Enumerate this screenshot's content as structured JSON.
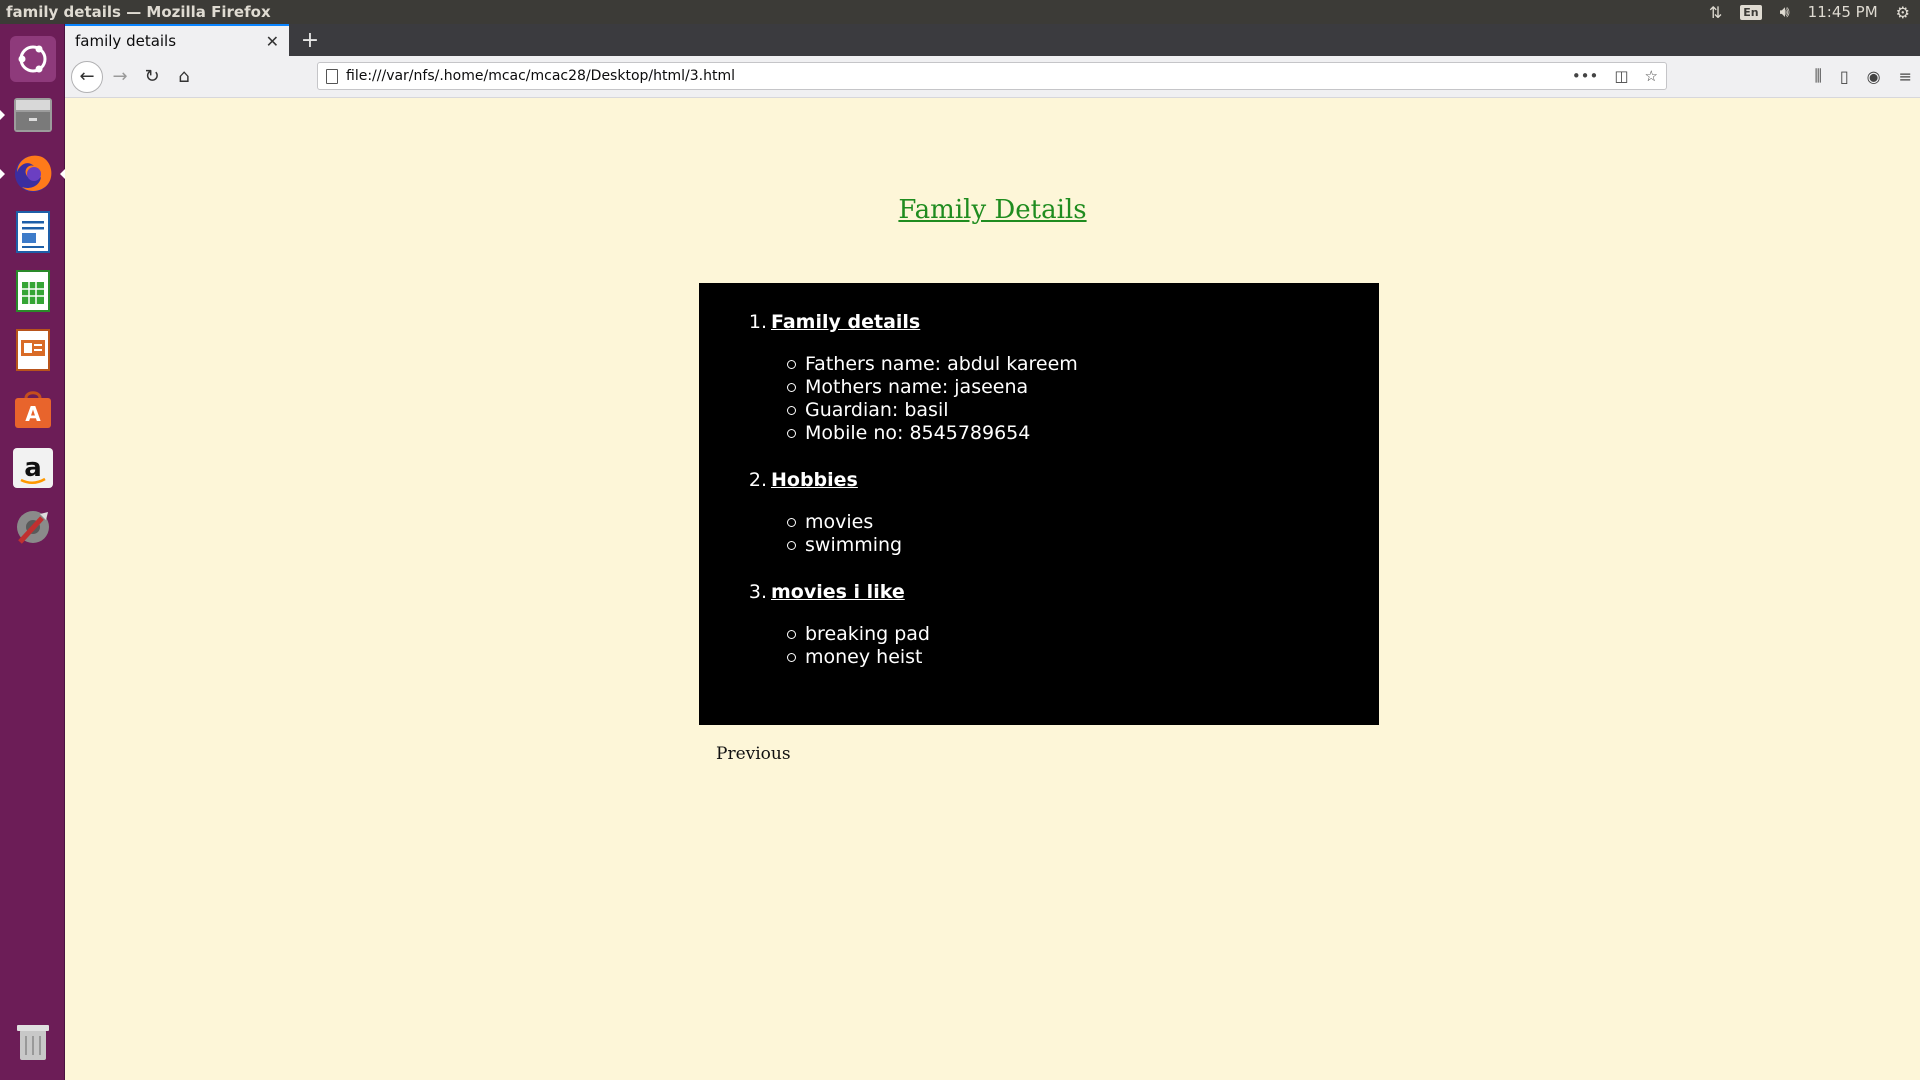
{
  "system": {
    "window_title": "family details — Mozilla Firefox",
    "lang": "En",
    "clock": "11:45 PM"
  },
  "launcher": {
    "items": [
      {
        "name": "ubuntu-dash-icon"
      },
      {
        "name": "files-icon"
      },
      {
        "name": "firefox-icon"
      },
      {
        "name": "writer-icon"
      },
      {
        "name": "calc-icon"
      },
      {
        "name": "impress-icon"
      },
      {
        "name": "software-center-icon"
      },
      {
        "name": "amazon-icon"
      },
      {
        "name": "system-settings-icon"
      },
      {
        "name": "trash-icon"
      }
    ]
  },
  "browser": {
    "tab_title": "family details",
    "url": "file:///var/nfs/.home/mcac/mcac28/Desktop/html/3.html"
  },
  "page": {
    "title": "Family Details",
    "sections": [
      {
        "num": "1.",
        "label": "Family details",
        "items": [
          "Fathers name: abdul kareem",
          "Mothers name: jaseena",
          "Guardian: basil",
          "Mobile no: 8545789654"
        ]
      },
      {
        "num": "2.",
        "label": "Hobbies",
        "items": [
          "movies",
          "swimming"
        ]
      },
      {
        "num": "3.",
        "label": "movies i like",
        "items": [
          "breaking pad",
          "money heist"
        ]
      }
    ],
    "previous_label": "Previous"
  },
  "colors": {
    "page_bg": "#fdf6d8",
    "title_color": "#1f8c1f",
    "launcher_bg": "#6c1d57",
    "topbar_bg": "#3c3b37"
  }
}
